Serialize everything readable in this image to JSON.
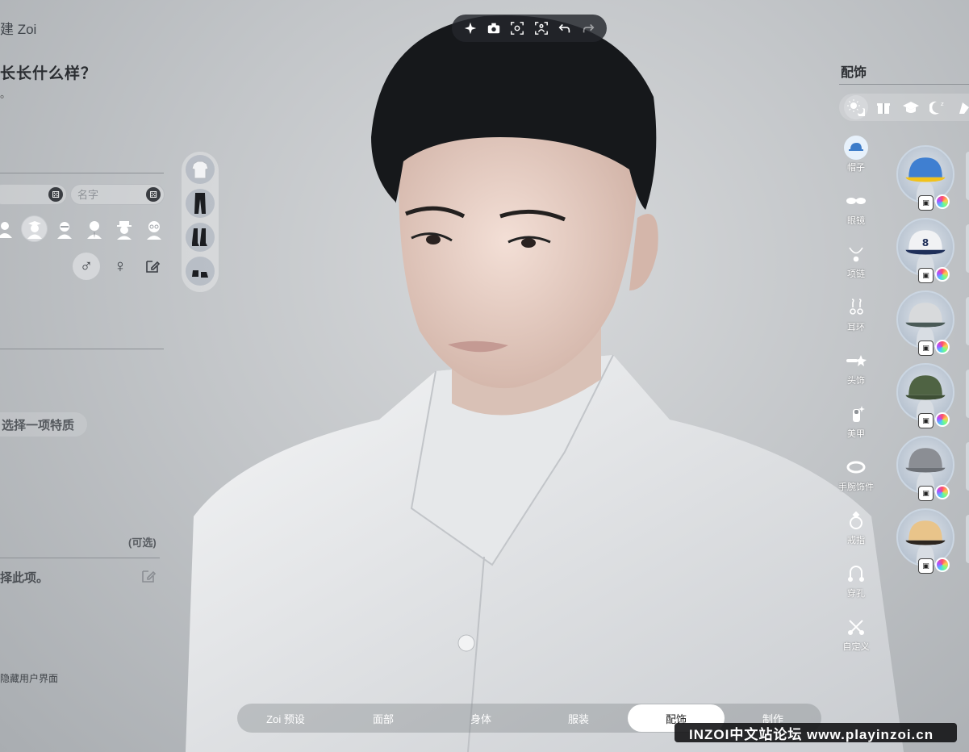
{
  "header": {
    "title": "建 Zoi"
  },
  "left_panel": {
    "question": "长长什么样？",
    "question_sub": "。",
    "name_field_1_placeholder": "",
    "name_field_2_placeholder": "名字",
    "trait_prompt": "选择一项特质",
    "optional_label": "(可选)",
    "select_this": "择此项。",
    "hide_ui": "隐藏用户界面"
  },
  "camera_toolbar": {
    "icons": [
      "sparkle-icon",
      "camera-icon",
      "face-focus-icon",
      "body-focus-icon",
      "undo-icon",
      "redo-icon"
    ]
  },
  "accessories": {
    "title": "配饰",
    "filters": [
      "day-night-icon",
      "gift-icon",
      "graduation-cap-icon",
      "sleep-icon",
      "more-icon"
    ],
    "categories": [
      {
        "label": "帽子",
        "icon": "hat-icon",
        "active": true
      },
      {
        "label": "眼镜",
        "icon": "glasses-icon"
      },
      {
        "label": "项链",
        "icon": "necklace-icon"
      },
      {
        "label": "耳环",
        "icon": "earring-icon"
      },
      {
        "label": "头饰",
        "icon": "headpiece-icon"
      },
      {
        "label": "美甲",
        "icon": "nail-icon"
      },
      {
        "label": "手腕饰件",
        "icon": "wrist-icon"
      },
      {
        "label": "戒指",
        "icon": "ring-icon"
      },
      {
        "label": "穿孔",
        "icon": "piercing-icon"
      },
      {
        "label": "自定义",
        "icon": "custom-icon"
      }
    ],
    "hats": [
      {
        "color": "#3f7fd1",
        "brim": "#f2c21b"
      },
      {
        "color": "#f1f2f4",
        "brim": "#1f2f59",
        "number": "8"
      },
      {
        "color": "#d8dadc",
        "brim": "#4a5a57"
      },
      {
        "color": "#4f6343",
        "brim": "#3e4f35"
      },
      {
        "color": "#8b8e94",
        "brim": "#6c7076"
      },
      {
        "color": "#e9c48a",
        "brim": "#2d2620"
      }
    ]
  },
  "tabs": [
    {
      "label": "Zoi 预设"
    },
    {
      "label": "面部"
    },
    {
      "label": "身体"
    },
    {
      "label": "服装"
    },
    {
      "label": "配饰",
      "active": true
    },
    {
      "label": "制作"
    }
  ],
  "watermark": "INZOI中文站论坛 www.playinzoi.cn"
}
